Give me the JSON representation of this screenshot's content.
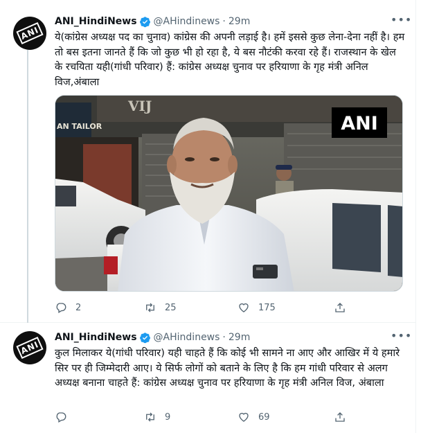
{
  "tweets": [
    {
      "author_name": "ANI_HindiNews",
      "handle": "@AHindinews",
      "separator": "·",
      "time": "29m",
      "text": "ये(कांग्रेस अध्यक्ष पद का चुनाव) कांग्रेस की अपनी लड़ाई है। हमें इससे कुछ लेना-देना नहीं है। हम तो बस इतना जानते हैं कि जो कुछ भी हो रहा है, ये बस नौटंकी करवा रहे हैं। राजस्थान के खेल के रचयिता यही(गांधी परिवार) हैं: कांग्रेस अध्यक्ष चुनाव पर हरियाणा के गृह मंत्री अनिल विज,अंबाला",
      "media": {
        "watermark": "ANI",
        "sign_text": "VIJ",
        "shop_text": "AN TAILOR"
      },
      "replies": "2",
      "retweets": "25",
      "likes": "175"
    },
    {
      "author_name": "ANI_HindiNews",
      "handle": "@AHindinews",
      "separator": "·",
      "time": "29m",
      "text": "कुल मिलाकर ये(गांधी परिवार) यही चाहते हैं कि कोई भी सामने ना आए और आखिर में ये हमारे सिर पर ही जिम्मेदारी आए। ये सिर्फ लोगों को बताने के लिए है कि हम गांधी परिवार से अलग अध्यक्ष बनाना चाहते हैं: कांग्रेस अध्यक्ष चुनाव पर हरियाणा के गृह मंत्री अनिल विज, अंबाला",
      "replies": "",
      "retweets": "9",
      "likes": "69"
    }
  ],
  "avatar_logo": "ANI",
  "colors": {
    "verified": "#1d9bf0",
    "secondary_text": "#536471",
    "thread_line": "#cfd9de"
  },
  "icons": [
    "verified-badge-icon",
    "more-icon",
    "reply-icon",
    "retweet-icon",
    "like-icon",
    "share-icon"
  ]
}
